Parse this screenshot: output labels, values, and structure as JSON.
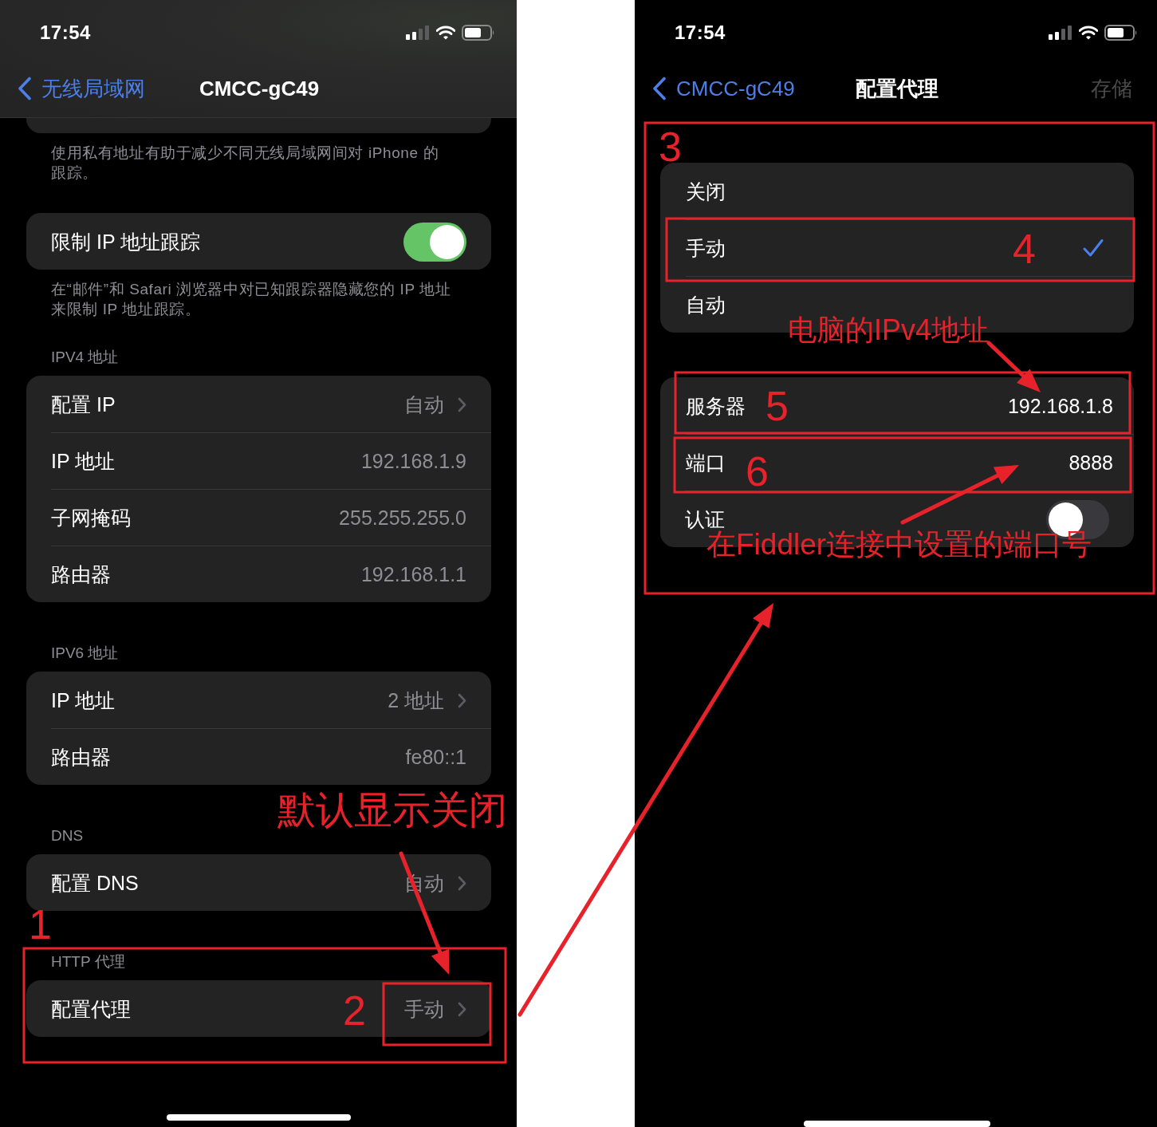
{
  "screens": [
    {
      "status_bar": {
        "time": "17:54"
      },
      "nav": {
        "back": "无线局域网",
        "title": "CMCC-gC49"
      },
      "groups": [
        {
          "kind": "partial",
          "footer": "使用私有地址有助于减少不同无线局域网间对 iPhone 的跟踪。"
        },
        {
          "kind": "list",
          "rows": [
            {
              "kind": "toggle",
              "label": "限制 IP 地址跟踪",
              "on": true
            }
          ],
          "footer": "在“邮件”和 Safari 浏览器中对已知跟踪器隐藏您的 IP 地址来限制 IP 地址跟踪。"
        },
        {
          "kind": "list",
          "header": "IPV4 地址",
          "rows": [
            {
              "kind": "value",
              "label": "配置 IP",
              "value": "自动",
              "chevron": true
            },
            {
              "kind": "value",
              "label": "IP 地址",
              "value": "192.168.1.9"
            },
            {
              "kind": "value",
              "label": "子网掩码",
              "value": "255.255.255.0"
            },
            {
              "kind": "value",
              "label": "路由器",
              "value": "192.168.1.1"
            }
          ]
        },
        {
          "kind": "list",
          "header": "IPV6 地址",
          "rows": [
            {
              "kind": "value",
              "label": "IP 地址",
              "value": "2 地址",
              "chevron": true
            },
            {
              "kind": "value",
              "label": "路由器",
              "value": "fe80::1"
            }
          ]
        },
        {
          "kind": "list",
          "header": "DNS",
          "rows": [
            {
              "kind": "value",
              "label": "配置 DNS",
              "value": "自动",
              "chevron": true
            }
          ]
        },
        {
          "kind": "list",
          "header": "HTTP 代理",
          "rows": [
            {
              "kind": "value",
              "label": "配置代理",
              "value": "手动",
              "chevron": true
            }
          ]
        }
      ]
    },
    {
      "status_bar": {
        "time": "17:54"
      },
      "nav": {
        "back": "CMCC-gC49",
        "title": "配置代理",
        "action": {
          "label": "存储",
          "disabled": true
        }
      },
      "groups": [
        {
          "kind": "list",
          "rows": [
            {
              "kind": "option",
              "label": "关闭",
              "selected": false
            },
            {
              "kind": "option",
              "label": "手动",
              "selected": true
            },
            {
              "kind": "option",
              "label": "自动",
              "selected": false
            }
          ]
        },
        {
          "kind": "list",
          "rows": [
            {
              "kind": "field",
              "label": "服务器",
              "value": "192.168.1.8"
            },
            {
              "kind": "field",
              "label": "端口",
              "value": "8888"
            },
            {
              "kind": "toggle",
              "label": "认证",
              "on": false
            }
          ]
        }
      ]
    }
  ],
  "annotations": {
    "step_numbers": [
      "1",
      "2",
      "3",
      "4",
      "5",
      "6"
    ],
    "notes": [
      "默认显示关闭",
      "电脑的IPv4地址",
      "在Fiddler连接中设置的端口号"
    ]
  }
}
